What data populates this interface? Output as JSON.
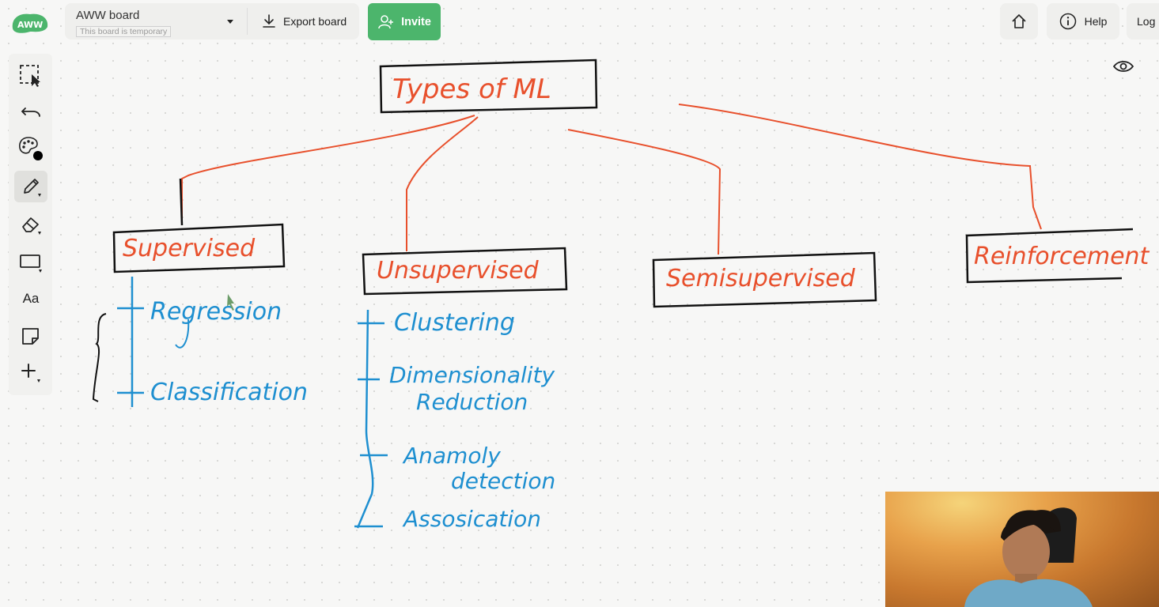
{
  "header": {
    "board_name": "AWW board",
    "board_status": "This board is temporary",
    "export_label": "Export board",
    "invite_label": "Invite",
    "help_label": "Help",
    "login_label": "Log I"
  },
  "logo_text": "AWW",
  "toolbar": {
    "text_tool_label": "Aa"
  },
  "drawing": {
    "root": "Types of ML",
    "categories": [
      "Supervised",
      "Unsupervised",
      "Semisupervised",
      "Reinforcement"
    ],
    "supervised_items": [
      "Regression",
      "Classification"
    ],
    "unsupervised_items": [
      "Clustering",
      "Dimensionality",
      "Reduction",
      "Anamoly",
      "detection",
      "Assosication"
    ]
  },
  "colors": {
    "accent_green": "#4cb56c",
    "ink_red": "#e8502c",
    "ink_blue": "#1e8fd0"
  }
}
